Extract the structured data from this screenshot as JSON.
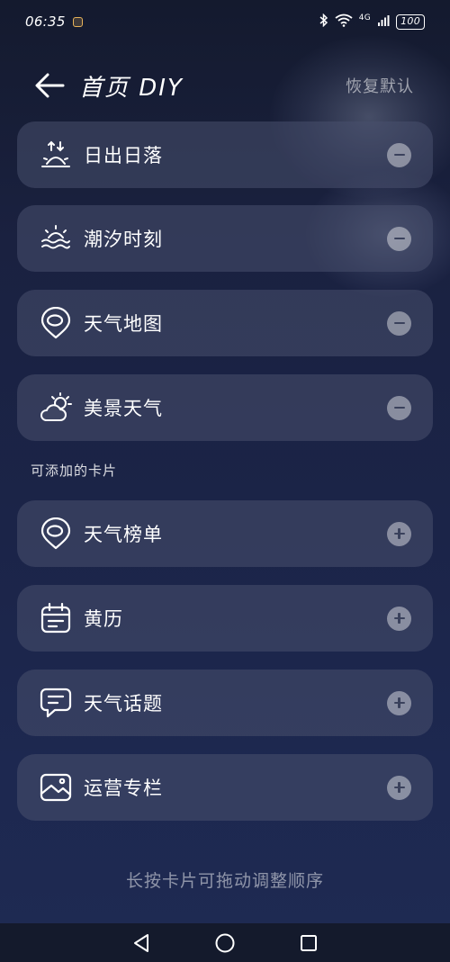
{
  "status_bar": {
    "time": "06:35",
    "network": "4G",
    "battery": "100"
  },
  "header": {
    "title": "首页 DIY",
    "reset_label": "恢复默认"
  },
  "active_cards": [
    {
      "label": "日出日落",
      "icon": "sunrise-icon",
      "action": "remove"
    },
    {
      "label": "潮汐时刻",
      "icon": "tide-icon",
      "action": "remove"
    },
    {
      "label": "天气地图",
      "icon": "map-pin-icon",
      "action": "remove"
    },
    {
      "label": "美景天气",
      "icon": "partly-cloudy-icon",
      "action": "remove"
    }
  ],
  "available_section_label": "可添加的卡片",
  "available_cards": [
    {
      "label": "天气榜单",
      "icon": "ranking-pin-icon",
      "action": "add"
    },
    {
      "label": "黄历",
      "icon": "calendar-icon",
      "action": "add"
    },
    {
      "label": "天气话题",
      "icon": "chat-bubble-icon",
      "action": "add"
    },
    {
      "label": "运营专栏",
      "icon": "image-icon",
      "action": "add"
    }
  ],
  "hint": "长按卡片可拖动调整顺序",
  "colors": {
    "background_top": "#141a2e",
    "background_bottom": "#1e2a52",
    "card": "#48506e",
    "action_button": "#9aa0b4"
  }
}
